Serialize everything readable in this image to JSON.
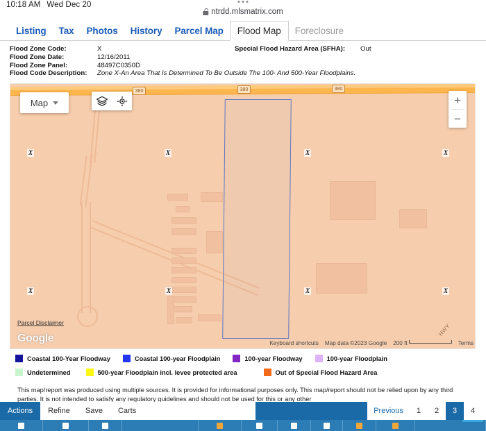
{
  "statusbar": {
    "time": "10:18 AM",
    "date": "Wed Dec 20",
    "url": "ntrdd.mlsmatrix.com",
    "lock_icon": "lock-icon",
    "menu_dots": "more-dots-icon"
  },
  "tabs": [
    {
      "label": "Listing",
      "state": "link"
    },
    {
      "label": "Tax",
      "state": "link"
    },
    {
      "label": "Photos",
      "state": "link"
    },
    {
      "label": "History",
      "state": "link"
    },
    {
      "label": "Parcel Map",
      "state": "link"
    },
    {
      "label": "Flood Map",
      "state": "active"
    },
    {
      "label": "Foreclosure",
      "state": "disabled"
    }
  ],
  "flood_info": {
    "rows": [
      {
        "label": "Flood Zone Code:",
        "value": "X"
      },
      {
        "label": "Flood Zone Date:",
        "value": "12/16/2011"
      },
      {
        "label": "Flood Zone Panel:",
        "value": "48497C0350D"
      },
      {
        "label": "Flood Code Description:",
        "value": "Zone X-An Area That Is Determined To Be Outside The 100- And 500-Year Floodplains."
      }
    ],
    "sfha_label": "Special Flood Hazard Area (SFHA):",
    "sfha_value": "Out"
  },
  "map": {
    "type_button": "Map",
    "type_caret": "chevron-down-icon",
    "layers_icon": "layers-icon",
    "locate_icon": "crosshair-target-icon",
    "zoom_in": "+",
    "zoom_out": "−",
    "parcel_disclaimer": "Parcel Disclaimer",
    "google_logo": "Google",
    "keyboard_shortcuts": "Keyboard shortcuts",
    "map_data": "Map data ©2023 Google",
    "scale": "200 ft",
    "terms": "Terms",
    "highway_shields": [
      "380",
      "380",
      "380"
    ],
    "hwy_label": "HWY",
    "zone_markers": [
      "X",
      "X",
      "X",
      "X",
      "X",
      "X",
      "X",
      "X"
    ],
    "parcel_outline_color": "#5b77c4",
    "base_color": "#f6cdad",
    "highway_color": "#fcb64d"
  },
  "legend": {
    "rows": [
      [
        {
          "label": "Coastal 100-Year Floodway",
          "color": "#14149b"
        },
        {
          "label": "Coastal 100-year Floodplain",
          "color": "#2437f0"
        },
        {
          "label": "100-year Floodway",
          "color": "#8226c4"
        },
        {
          "label": "100-year Floodplain",
          "color": "#ddb2f7"
        }
      ],
      [
        {
          "label": "Undetermined",
          "color": "#c9f5cc"
        },
        {
          "label": "500-year Floodplain incl. levee protected area",
          "color": "#fcf714"
        },
        {
          "label": "Out of Special Flood Hazard Area",
          "color": "#f26a18"
        }
      ]
    ]
  },
  "disclaimer": {
    "text": "This map/report was produced using multiple sources. It is provided for informational purposes only. This map/report should not be relied upon by any third parties. It is not intended to satisfy any regulatory guidelines and should not be used for this or any other"
  },
  "actionbar": {
    "tabs": [
      {
        "label": "Actions",
        "state": "active"
      },
      {
        "label": "Refine",
        "state": "normal"
      },
      {
        "label": "Save",
        "state": "normal"
      },
      {
        "label": "Carts",
        "state": "normal"
      }
    ],
    "previous": "Previous",
    "pages": [
      {
        "label": "1",
        "current": false
      },
      {
        "label": "2",
        "current": false
      },
      {
        "label": "3",
        "current": true
      },
      {
        "label": "4",
        "current": false
      }
    ],
    "accent_color": "#1a6aa8"
  }
}
